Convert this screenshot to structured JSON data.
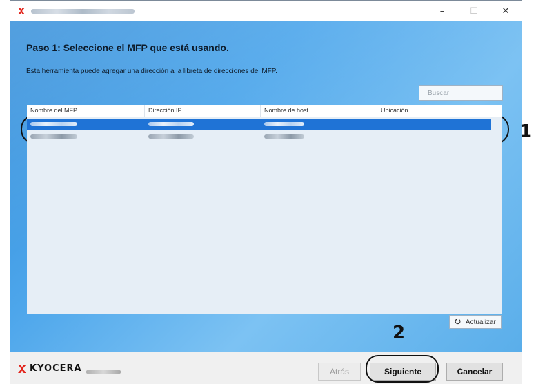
{
  "window": {
    "controls": {
      "minimize": "–",
      "maximize": "☐",
      "close": "✕"
    }
  },
  "page": {
    "step_title": "Paso 1: Seleccione el MFP que está usando.",
    "description": "Esta herramienta puede agregar una dirección a la libreta de direcciones del MFP.",
    "search_placeholder": "Buscar"
  },
  "table": {
    "columns": [
      "Nombre del MFP",
      "Dirección IP",
      "Nombre de host",
      "Ubicación"
    ],
    "rows_count_visible": 2,
    "selected_row": 1
  },
  "actions": {
    "refresh_label": "Actualizar",
    "back_label": "Atrás",
    "next_label": "Siguiente",
    "cancel_label": "Cancelar"
  },
  "branding": {
    "logo_text": "KYOCERA"
  },
  "callouts": {
    "first": "1",
    "second": "2"
  },
  "colors": {
    "accent": "#1f73d6",
    "logo_red": "#e2231a",
    "panel_blue": "#4da6eb"
  },
  "icons": {
    "app": "kyocera-icon",
    "refresh": "refresh-icon"
  }
}
